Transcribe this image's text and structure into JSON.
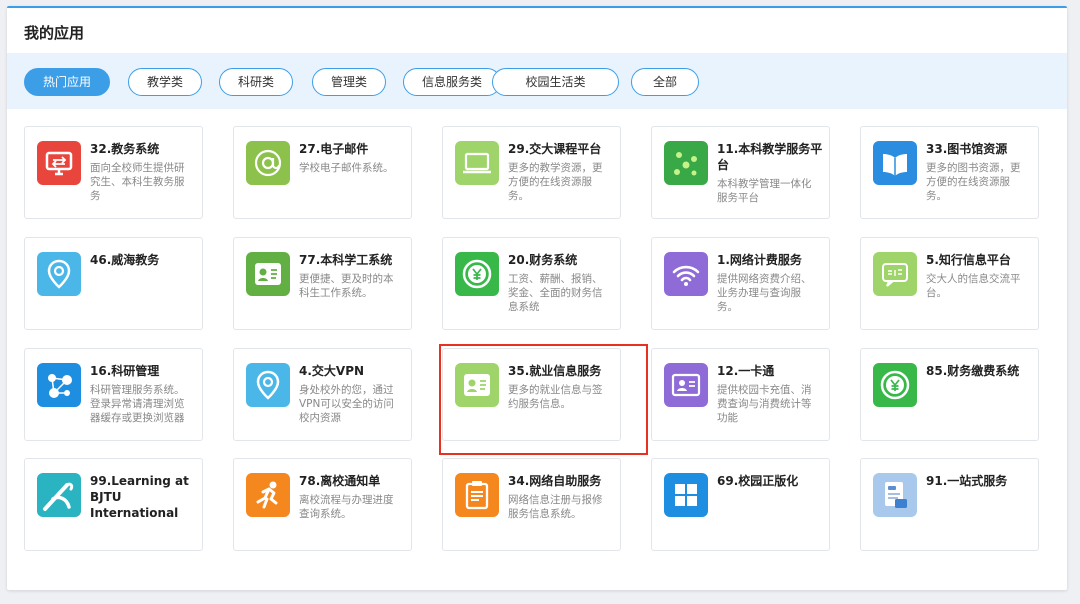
{
  "panel": {
    "title": "我的应用"
  },
  "tabs": [
    {
      "label": "热门应用",
      "active": true
    },
    {
      "label": "教学类",
      "active": false
    },
    {
      "label": "科研类",
      "active": false
    },
    {
      "label": "管理类",
      "active": false
    },
    {
      "label": "信息服务类",
      "active": false
    },
    {
      "label": "校园生活类",
      "active": false
    },
    {
      "label": "全部",
      "active": false
    }
  ],
  "apps": [
    {
      "title": "32.教务系统",
      "desc": "面向全校师生提供研究生、本科生教务服务",
      "icon": "monitor-icon",
      "color": "#e8463d"
    },
    {
      "title": "27.电子邮件",
      "desc": "学校电子邮件系统。",
      "icon": "at-sign-icon",
      "color": "#8cc24c"
    },
    {
      "title": "29.交大课程平台",
      "desc": "更多的教学资源，更方便的在线资源服务。",
      "icon": "laptop-icon",
      "color": "#9fd46a"
    },
    {
      "title": "11.本科教学服务平台",
      "desc": "本科教学管理一体化服务平台",
      "icon": "dots-icon",
      "color": "#39a847"
    },
    {
      "title": "33.图书馆资源",
      "desc": "更多的图书资源，更方便的在线资源服务。",
      "icon": "book-icon",
      "color": "#2b8de0"
    },
    {
      "title": "46.威海教务",
      "desc": "",
      "icon": "location-pin-icon",
      "color": "#4bb7e8"
    },
    {
      "title": "77.本科学工系统",
      "desc": "更便捷、更及时的本科生工作系统。",
      "icon": "id-card-icon",
      "color": "#62b043"
    },
    {
      "title": "20.财务系统",
      "desc": "工资、薪酬、报销、奖金、全面的财务信息系统",
      "icon": "yuan-coin-icon",
      "color": "#39b84a"
    },
    {
      "title": "1.网络计费服务",
      "desc": "提供网络资费介绍、业务办理与查询服务。",
      "icon": "wifi-icon",
      "color": "#8f6bd8"
    },
    {
      "title": "5.知行信息平台",
      "desc": "交大人的信息交流平台。",
      "icon": "chat-bubble-icon",
      "color": "#9fd46a"
    },
    {
      "title": "16.科研管理",
      "desc": "科研管理服务系统。登录异常请清理浏览器缓存或更换浏览器",
      "icon": "molecule-icon",
      "color": "#1e8fe0"
    },
    {
      "title": "4.交大VPN",
      "desc": "身处校外的您，通过VPN可以安全的访问校内资源",
      "icon": "location-pin-icon",
      "color": "#4bb7e8"
    },
    {
      "title": "35.就业信息服务",
      "desc": "更多的就业信息与签约服务信息。",
      "icon": "id-card-icon",
      "color": "#9fd46a"
    },
    {
      "title": "12.一卡通",
      "desc": "提供校园卡充值、消费查询与消费统计等功能",
      "icon": "card-icon",
      "color": "#8f6bd8"
    },
    {
      "title": "85.财务缴费系统",
      "desc": "",
      "icon": "yuan-coin-icon",
      "color": "#39b84a"
    },
    {
      "title": "99.Learning at BJTU International",
      "desc": "",
      "icon": "learning-logo-icon",
      "color": "#2ab3c0"
    },
    {
      "title": "78.离校通知单",
      "desc": "离校流程与办理进度查询系统。",
      "icon": "running-person-icon",
      "color": "#f5871f"
    },
    {
      "title": "34.网络自助服务",
      "desc": "网络信息注册与报修服务信息系统。",
      "icon": "clipboard-icon",
      "color": "#f5871f"
    },
    {
      "title": "69.校园正版化",
      "desc": "",
      "icon": "windows-icon",
      "color": "#1e8fe0"
    },
    {
      "title": "91.一站式服务",
      "desc": "",
      "icon": "form-stamp-icon",
      "color": "#a9c9ec"
    }
  ]
}
